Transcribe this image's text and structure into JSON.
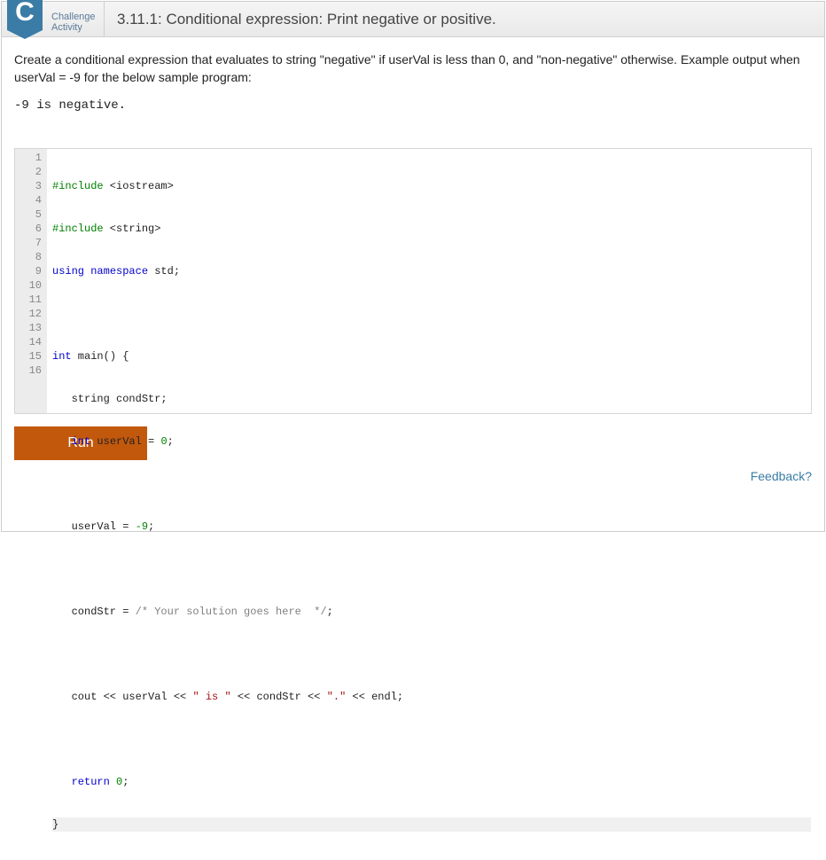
{
  "header": {
    "badge_letter": "C",
    "badge_label_line1": "Challenge",
    "badge_label_line2": "Activity",
    "title": "3.11.1: Conditional expression: Print negative or positive."
  },
  "instructions": "Create a conditional expression that evaluates to string \"negative\" if userVal is less than 0, and \"non-negative\" otherwise. Example output when userVal = -9 for the below sample program:",
  "sample_output": "-9 is negative.",
  "code": {
    "line1_a": "#include",
    "line1_b": " <iostream>",
    "line2_a": "#include",
    "line2_b": " <string>",
    "line3_a": "using",
    "line3_b": " namespace",
    "line3_c": " std;",
    "line5_a": "int",
    "line5_b": " main() {",
    "line6": "   string condStr;",
    "line7_a": "   int",
    "line7_b": " userVal = ",
    "line7_c": "0",
    "line7_d": ";",
    "line9_a": "   userVal = ",
    "line9_b": "-9",
    "line9_c": ";",
    "line11_a": "   condStr = ",
    "line11_b": "/* Your solution goes here  */",
    "line11_c": ";",
    "line13_a": "   cout << userVal << ",
    "line13_b": "\" is \"",
    "line13_c": " << condStr << ",
    "line13_d": "\".\"",
    "line13_e": " << endl;",
    "line15_a": "   return",
    "line15_b": " ",
    "line15_c": "0",
    "line15_d": ";",
    "line16": "}"
  },
  "gutter": [
    "1",
    "2",
    "3",
    "4",
    "5",
    "6",
    "7",
    "8",
    "9",
    "10",
    "11",
    "12",
    "13",
    "14",
    "15",
    "16"
  ],
  "buttons": {
    "run": "Run"
  },
  "links": {
    "feedback": "Feedback?"
  }
}
